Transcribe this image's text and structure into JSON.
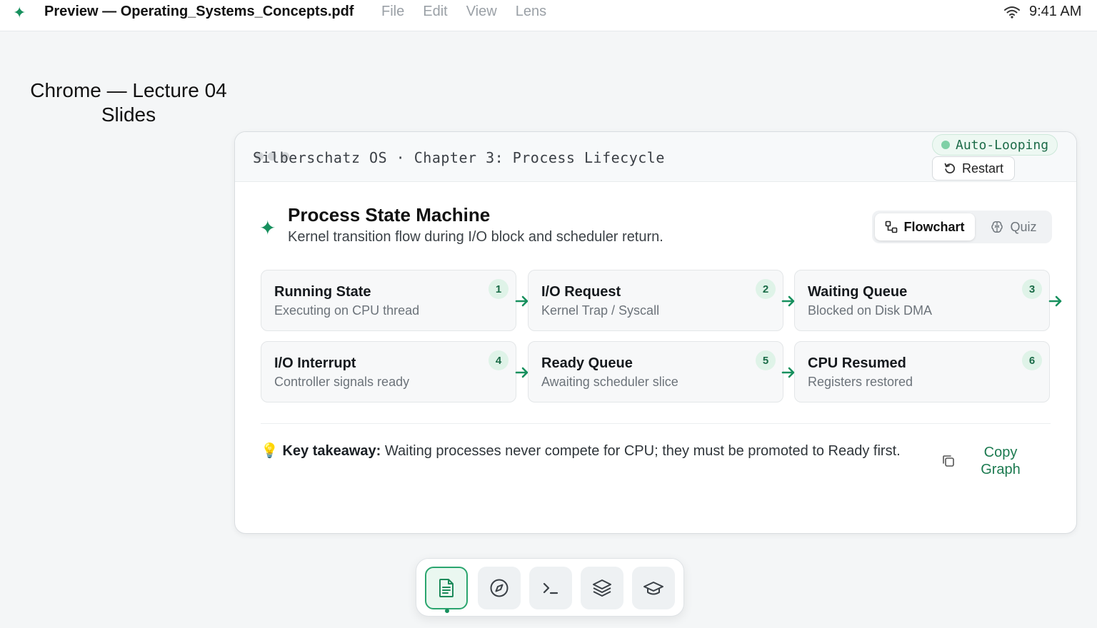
{
  "menubar": {
    "app_title": "Preview — Operating_Systems_Concepts.pdf",
    "menus": [
      "File",
      "Edit",
      "View",
      "Lens"
    ],
    "clock": "9:41 AM"
  },
  "caption": "Chrome — Lecture 04 Slides",
  "card": {
    "breadcrumb": "Silberschatz OS · Chapter 3: Process Lifecycle",
    "status_pill": "Auto-Looping",
    "restart_label": "Restart",
    "title": "Process State Machine",
    "subtitle": "Kernel transition flow during I/O block and scheduler return.",
    "view_toggle": {
      "flowchart": "Flowchart",
      "quiz": "Quiz"
    },
    "steps": [
      {
        "num": "1",
        "name": "Running State",
        "desc": "Executing on CPU thread"
      },
      {
        "num": "2",
        "name": "I/O Request",
        "desc": "Kernel Trap / Syscall"
      },
      {
        "num": "3",
        "name": "Waiting Queue",
        "desc": "Blocked on Disk DMA"
      },
      {
        "num": "4",
        "name": "I/O Interrupt",
        "desc": "Controller signals ready"
      },
      {
        "num": "5",
        "name": "Ready Queue",
        "desc": "Awaiting scheduler slice"
      },
      {
        "num": "6",
        "name": "CPU Resumed",
        "desc": "Registers restored"
      }
    ],
    "takeaway_label": "Key takeaway:",
    "takeaway_text": "Waiting processes never compete for CPU; they must be promoted to Ready first.",
    "copy_label": "Copy Graph"
  },
  "dock": [
    "document",
    "compass",
    "terminal",
    "layers",
    "graduation-cap"
  ],
  "colors": {
    "accent": "#17905e",
    "accent_light": "#dff3e8"
  }
}
